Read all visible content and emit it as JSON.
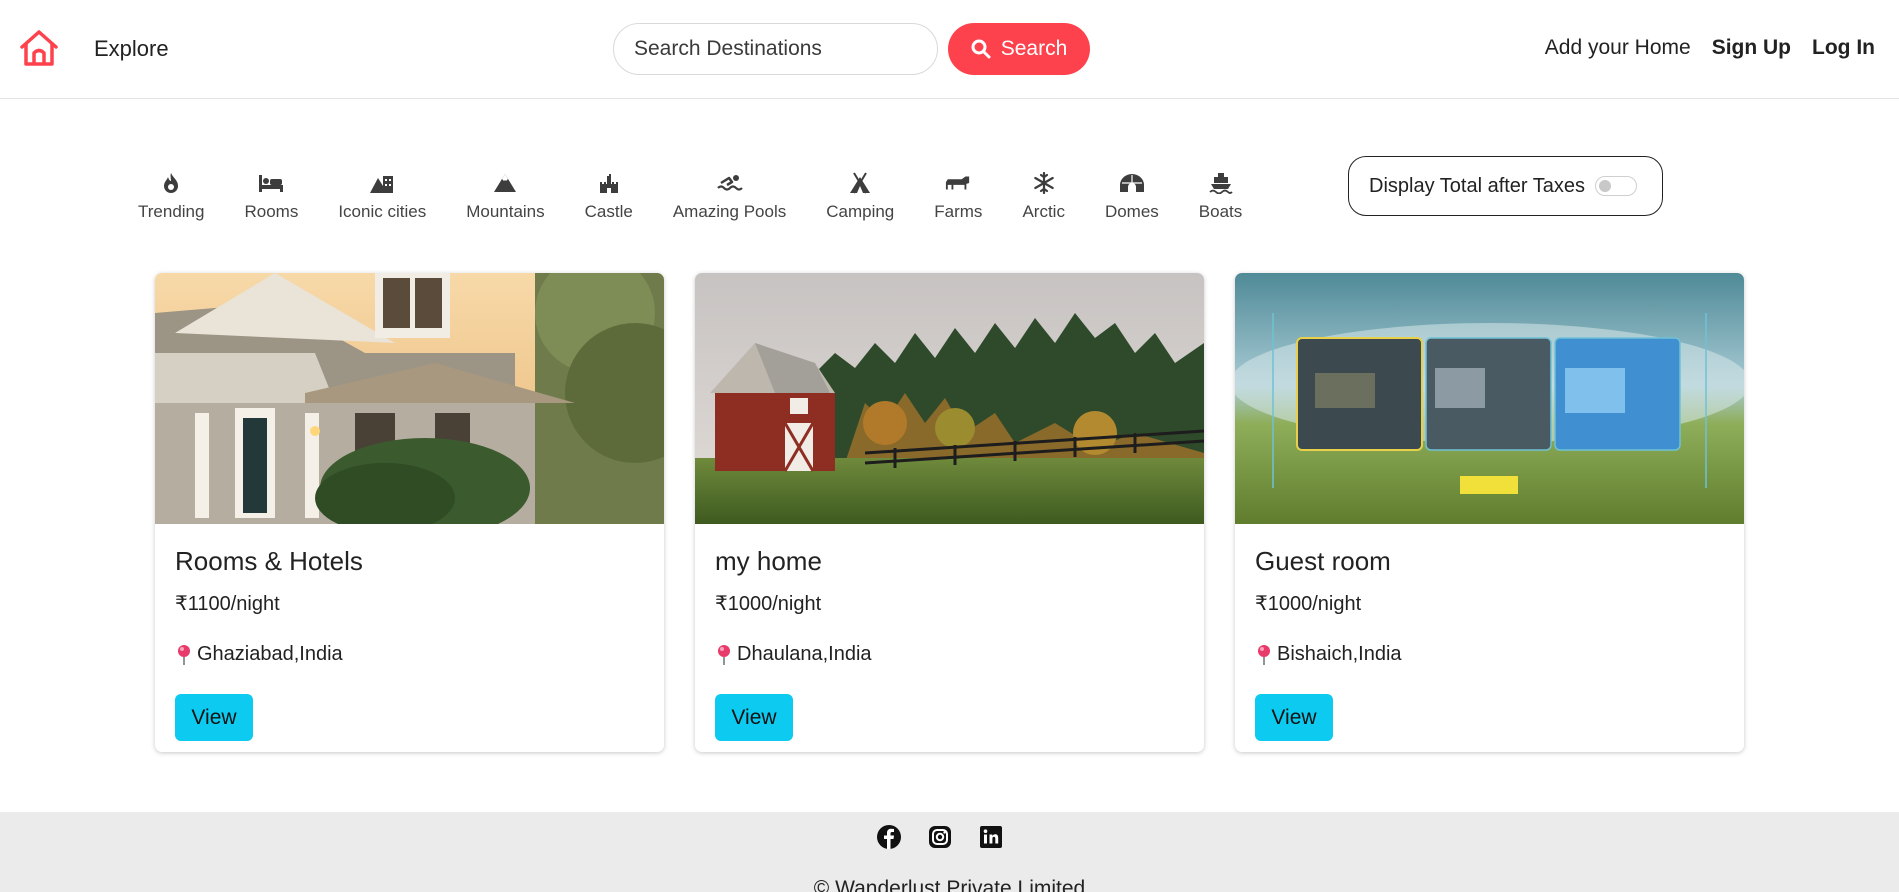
{
  "navbar": {
    "explore": "Explore",
    "search_placeholder": "Search Destinations",
    "search_button": "Search",
    "add_home": "Add your Home",
    "sign_up": "Sign Up",
    "log_in": "Log In",
    "brand_color": "#fe424d"
  },
  "filters": [
    {
      "label": "Trending",
      "icon": "fire-icon"
    },
    {
      "label": "Rooms",
      "icon": "bed-icon"
    },
    {
      "label": "Iconic cities",
      "icon": "mountain-city-icon"
    },
    {
      "label": "Mountains",
      "icon": "mountain-icon"
    },
    {
      "label": "Castle",
      "icon": "castle-icon"
    },
    {
      "label": "Amazing Pools",
      "icon": "person-swimming-icon"
    },
    {
      "label": "Camping",
      "icon": "campground-icon"
    },
    {
      "label": "Farms",
      "icon": "cow-icon"
    },
    {
      "label": "Arctic",
      "icon": "snowflake-icon"
    },
    {
      "label": "Domes",
      "icon": "igloo-icon"
    },
    {
      "label": "Boats",
      "icon": "ferry-icon"
    }
  ],
  "tax_toggle": {
    "label": "Display Total after Taxes",
    "checked": false
  },
  "listings": [
    {
      "title": "Rooms & Hotels",
      "price": "₹1100/night",
      "location": "Ghaziabad,India",
      "view": "View"
    },
    {
      "title": "my home",
      "price": "₹1000/night",
      "location": "Dhaulana,India",
      "view": "View"
    },
    {
      "title": "Guest room",
      "price": "₹1000/night",
      "location": "Bishaich,India",
      "view": "View"
    }
  ],
  "footer": {
    "copyright": "© Wanderlust Private Limited",
    "socials": [
      "facebook-icon",
      "instagram-icon",
      "linkedin-icon"
    ]
  },
  "view_button_color": "#0dcaf0"
}
